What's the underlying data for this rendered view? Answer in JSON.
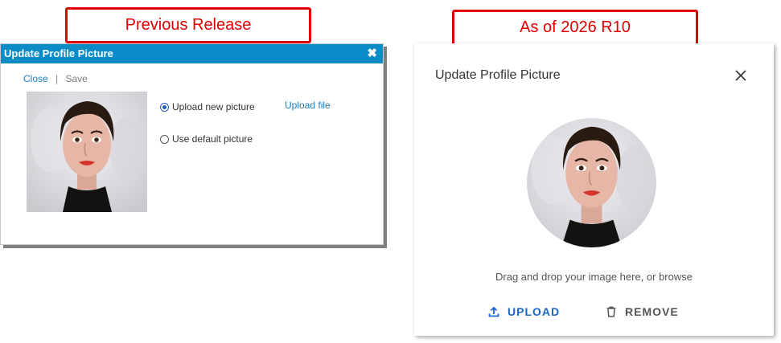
{
  "callouts": {
    "previous": "Previous Release",
    "current": "As of 2026 R10"
  },
  "old_dialog": {
    "title": "Update Profile Picture",
    "close_icon": "close-icon",
    "close_link": "Close",
    "separator": "|",
    "save_link": "Save",
    "options": [
      {
        "label": "Upload new picture",
        "checked": true
      },
      {
        "label": "Use default picture",
        "checked": false
      }
    ],
    "upload_file_link": "Upload file"
  },
  "new_dialog": {
    "title": "Update Profile Picture",
    "close_icon": "close-icon",
    "drop_text": "Drag and drop your image here, or browse",
    "upload_label": "UPLOAD",
    "upload_icon": "upload-icon",
    "remove_label": "REMOVE",
    "remove_icon": "trash-icon",
    "accent_color": "#1a66c9"
  },
  "colors": {
    "callout_red": "#e00000",
    "titlebar_blue": "#0b8cc6"
  }
}
